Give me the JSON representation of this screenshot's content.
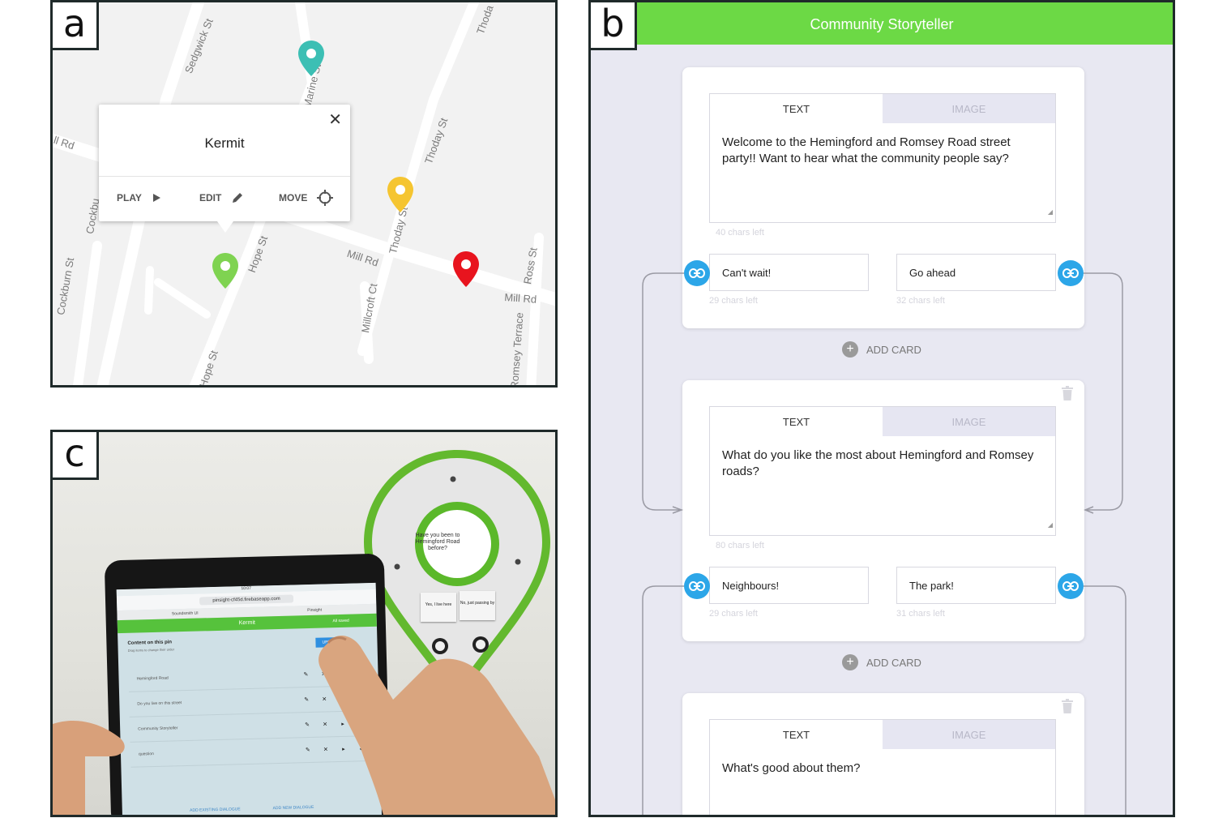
{
  "labels": {
    "a": "a",
    "b": "b",
    "c": "c"
  },
  "map": {
    "streets": {
      "sedgwick": "Sedgwick St",
      "marine": "Marine St",
      "thoday_top": "Thoda",
      "rd_left": "ll Rd",
      "cockburn_top": "Cockbu",
      "cockburn": "Cockburn St",
      "thoday_mid": "Thoday St",
      "thoday_low": "Thoday St",
      "hope_top": "Hope St",
      "hope_bottom": "Hope St",
      "mill_rd": "Mill Rd",
      "mill_rd_right": "Mill Rd",
      "millcroft": "Millcroft Ct",
      "ross": "Ross St",
      "romsey_terrace": "Romsey Terrace"
    },
    "popup": {
      "title": "Kermit",
      "close": "✕",
      "play": "PLAY",
      "edit": "EDIT",
      "move": "MOVE"
    },
    "pin_colors": {
      "teal": "#3cbfb4",
      "yellow": "#f5c531",
      "green": "#7fd351",
      "red": "#e8141e"
    }
  },
  "app": {
    "title": "Community Storyteller",
    "tab_text": "TEXT",
    "tab_image": "IMAGE",
    "add_card": "ADD CARD",
    "cards": [
      {
        "message": "Welcome to the Hemingford and Romsey Road street party!! Want to hear what the community people say?",
        "chars_left": "40 chars left",
        "responses": [
          {
            "label": "Can't wait!",
            "chars_left": "29 chars left"
          },
          {
            "label": "Go ahead",
            "chars_left": "32 chars left"
          }
        ]
      },
      {
        "message": "What do you like the most about Hemingford and Romsey roads?",
        "chars_left": "80 chars left",
        "responses": [
          {
            "label": "Neighbours!",
            "chars_left": "29 chars left"
          },
          {
            "label": "The park!",
            "chars_left": "31 chars left"
          }
        ]
      },
      {
        "message": "What's good about them?"
      }
    ],
    "accent": "#6cd945",
    "link_color": "#2ca6e8"
  },
  "photo": {
    "tablet": {
      "status": "10:07",
      "url": "pinsight-cf45d.firebaseapp.com",
      "tabs": [
        "Soundsmith UI",
        "Pinsight"
      ],
      "header": "Kermit",
      "header_right": "All saved",
      "content_heading": "Content on this pin",
      "content_sub": "Drag items to change their order",
      "update": "UPDATE",
      "rows": [
        "Hemingford Road",
        "Do you live on this street",
        "Community Storyteller",
        "question"
      ],
      "footer": [
        "ADD EXISTING DIALOGUE",
        "ADD NEW DIALOGUE"
      ]
    },
    "device": {
      "question": "Have you been to Hemingford Road before?",
      "btn_left": "Yes, I live here",
      "btn_right": "No, just passing by"
    }
  }
}
